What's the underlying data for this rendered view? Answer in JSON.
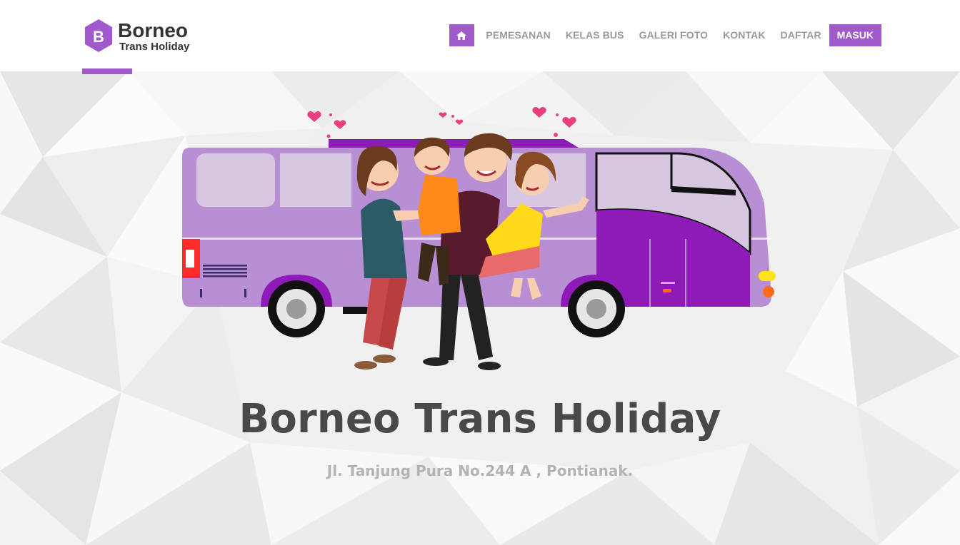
{
  "brand": {
    "logo_letter": "B",
    "name_line1": "Borneo",
    "name_line2": "Trans Holiday"
  },
  "nav": {
    "home_icon": "home-icon",
    "items": [
      "PEMESANAN",
      "KELAS BUS",
      "GALERI FOTO",
      "KONTAK",
      "DAFTAR"
    ],
    "login_label": "MASUK"
  },
  "hero": {
    "title": "Borneo Trans Holiday",
    "address": "Jl. Tanjung Pura No.244 A , Pontianak."
  },
  "colors": {
    "accent": "#a05acb",
    "bus_body": "#b98fd4",
    "bus_dark": "#8e1bb8",
    "title_text": "#474a47",
    "subtitle_text": "#b3b3b3",
    "nav_text": "#9a9a9a"
  }
}
